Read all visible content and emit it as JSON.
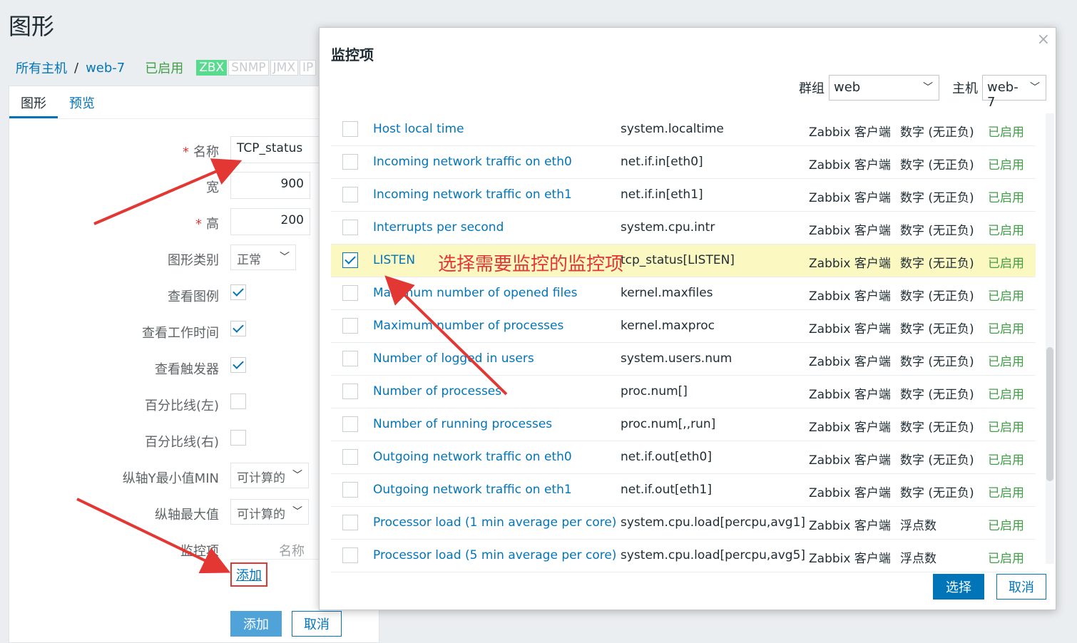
{
  "page": {
    "title": "图形",
    "breadcrumb": {
      "all_hosts": "所有主机",
      "separator": "/",
      "host": "web-7",
      "status": "已启用"
    },
    "protocols": [
      "ZBX",
      "SNMP",
      "JMX",
      "IP"
    ],
    "tabs": [
      "图形",
      "预览"
    ]
  },
  "form": {
    "name": {
      "label": "名称",
      "value": "TCP_status"
    },
    "width": {
      "label": "宽",
      "value": "900"
    },
    "height": {
      "label": "高",
      "value": "200"
    },
    "graph_type": {
      "label": "图形类别",
      "value": "正常"
    },
    "show_legend": {
      "label": "查看图例",
      "checked": true
    },
    "show_working_time": {
      "label": "查看工作时间",
      "checked": true
    },
    "show_triggers": {
      "label": "查看触发器",
      "checked": true
    },
    "percentile_left": {
      "label": "百分比线(左)",
      "checked": false
    },
    "percentile_right": {
      "label": "百分比线(右)",
      "checked": false
    },
    "y_min": {
      "label": "纵轴Y最小值MIN",
      "value": "可计算的"
    },
    "y_max": {
      "label": "纵轴最大值",
      "value": "可计算的"
    },
    "items": {
      "label": "监控项",
      "name_header": "名称",
      "add_link": "添加"
    },
    "add_button": "添加",
    "cancel_button": "取消"
  },
  "modal": {
    "title": "监控项",
    "close": "×",
    "group_label": "群组",
    "group_value": "web",
    "host_label": "主机",
    "host_value": "web-7",
    "select_button": "选择",
    "cancel_button": "取消",
    "rows": [
      {
        "name": "Host local time",
        "key": "system.localtime",
        "type": "Zabbix 客户端",
        "value_type": "数字 (无正负)",
        "status": "已启用",
        "checked": false
      },
      {
        "name": "Incoming network traffic on eth0",
        "key": "net.if.in[eth0]",
        "type": "Zabbix 客户端",
        "value_type": "数字 (无正负)",
        "status": "已启用",
        "checked": false
      },
      {
        "name": "Incoming network traffic on eth1",
        "key": "net.if.in[eth1]",
        "type": "Zabbix 客户端",
        "value_type": "数字 (无正负)",
        "status": "已启用",
        "checked": false
      },
      {
        "name": "Interrupts per second",
        "key": "system.cpu.intr",
        "type": "Zabbix 客户端",
        "value_type": "数字 (无正负)",
        "status": "已启用",
        "checked": false
      },
      {
        "name": "LISTEN",
        "key": "tcp_status[LISTEN]",
        "type": "Zabbix 客户端",
        "value_type": "数字 (无正负)",
        "status": "已启用",
        "checked": true
      },
      {
        "name": "Maximum number of opened files",
        "key": "kernel.maxfiles",
        "type": "Zabbix 客户端",
        "value_type": "数字 (无正负)",
        "status": "已启用",
        "checked": false
      },
      {
        "name": "Maximum number of processes",
        "key": "kernel.maxproc",
        "type": "Zabbix 客户端",
        "value_type": "数字 (无正负)",
        "status": "已启用",
        "checked": false
      },
      {
        "name": "Number of logged in users",
        "key": "system.users.num",
        "type": "Zabbix 客户端",
        "value_type": "数字 (无正负)",
        "status": "已启用",
        "checked": false
      },
      {
        "name": "Number of processes",
        "key": "proc.num[]",
        "type": "Zabbix 客户端",
        "value_type": "数字 (无正负)",
        "status": "已启用",
        "checked": false
      },
      {
        "name": "Number of running processes",
        "key": "proc.num[,,run]",
        "type": "Zabbix 客户端",
        "value_type": "数字 (无正负)",
        "status": "已启用",
        "checked": false
      },
      {
        "name": "Outgoing network traffic on eth0",
        "key": "net.if.out[eth0]",
        "type": "Zabbix 客户端",
        "value_type": "数字 (无正负)",
        "status": "已启用",
        "checked": false
      },
      {
        "name": "Outgoing network traffic on eth1",
        "key": "net.if.out[eth1]",
        "type": "Zabbix 客户端",
        "value_type": "数字 (无正负)",
        "status": "已启用",
        "checked": false
      },
      {
        "name": "Processor load (1 min average per core)",
        "key": "system.cpu.load[percpu,avg1]",
        "type": "Zabbix 客户端",
        "value_type": "浮点数",
        "status": "已启用",
        "checked": false
      },
      {
        "name": "Processor load (5 min average per core)",
        "key": "system.cpu.load[percpu,avg5]",
        "type": "Zabbix 客户端",
        "value_type": "浮点数",
        "status": "已启用",
        "checked": false
      }
    ]
  },
  "annotation": {
    "text": "选择需要监控的监控项",
    "color": "#e33734"
  },
  "colors": {
    "link": "#0275b8",
    "enabled": "#429e47",
    "selected_row": "#fbf8c1",
    "primary_button": "#0275b8"
  }
}
